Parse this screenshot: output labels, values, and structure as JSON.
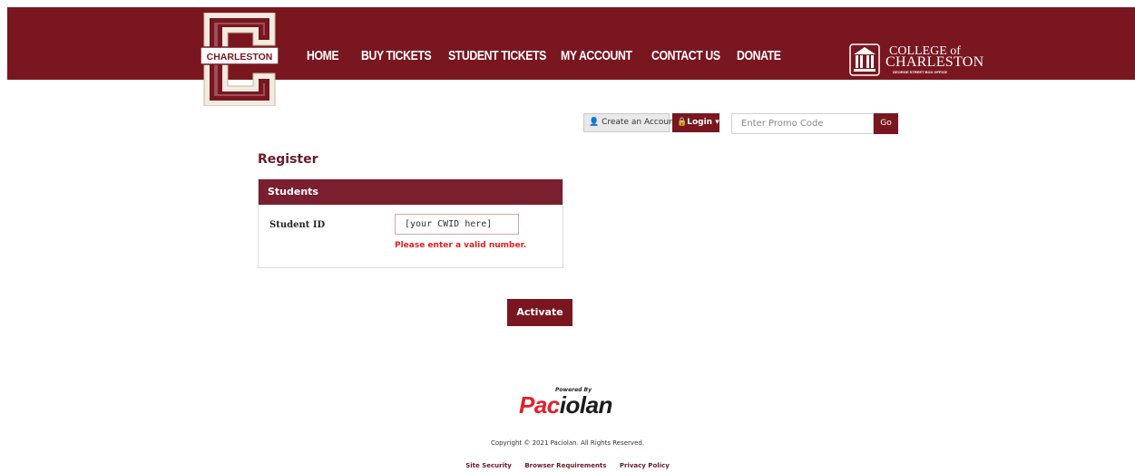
{
  "brand": {
    "logo_text": "CHARLESTON",
    "primary_color": "#7a1620",
    "error_color": "#e01e1e"
  },
  "nav": {
    "items": [
      {
        "label": "HOME"
      },
      {
        "label": "BUY TICKETS"
      },
      {
        "label": "STUDENT TICKETS"
      },
      {
        "label": "MY ACCOUNT"
      },
      {
        "label": "CONTACT US"
      },
      {
        "label": "DONATE"
      }
    ]
  },
  "partner_logo": {
    "line1": "COLLEGE of",
    "line2": "CHARLESTON",
    "line3": "GEORGE STREET BOX OFFICE"
  },
  "toolbar": {
    "create_account": "Create an Account",
    "login": "Login",
    "promo_placeholder": "Enter Promo Code",
    "go": "Go"
  },
  "page": {
    "title": "Register",
    "panel_title": "Students",
    "student_id_label": "Student ID",
    "student_id_value": "[your CWID here]",
    "error": "Please enter a valid number.",
    "submit": "Activate"
  },
  "footer": {
    "powered_by": "Powered By",
    "vendor_a": "Pac",
    "vendor_b": "iolan",
    "copyright": "Copyright © 2021 Paciolan. All Rights Reserved.",
    "links": [
      "Site Security",
      "Browser Requirements",
      "Privacy Policy"
    ]
  }
}
